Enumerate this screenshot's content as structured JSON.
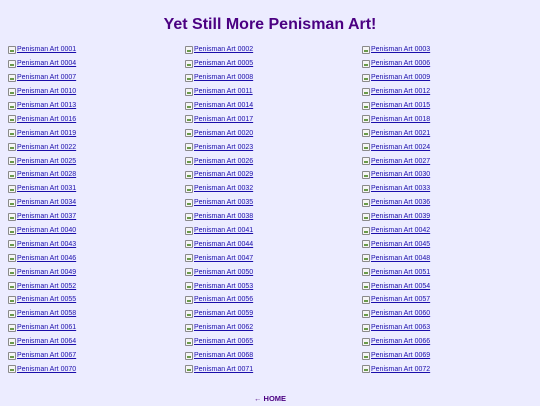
{
  "page": {
    "title": "Yet Still More Penisman Art!"
  },
  "gallery": {
    "items": [
      {
        "label": "Penisman Art 0001"
      },
      {
        "label": "Penisman Art 0002"
      },
      {
        "label": "Penisman Art 0003"
      },
      {
        "label": "Penisman Art 0004"
      },
      {
        "label": "Penisman Art 0005"
      },
      {
        "label": "Penisman Art 0006"
      },
      {
        "label": "Penisman Art 0007"
      },
      {
        "label": "Penisman Art 0008"
      },
      {
        "label": "Penisman Art 0009"
      },
      {
        "label": "Penisman Art 0010"
      },
      {
        "label": "Penisman Art 0011"
      },
      {
        "label": "Penisman Art 0012"
      },
      {
        "label": "Penisman Art 0013"
      },
      {
        "label": "Penisman Art 0014"
      },
      {
        "label": "Penisman Art 0015"
      },
      {
        "label": "Penisman Art 0016"
      },
      {
        "label": "Penisman Art 0017"
      },
      {
        "label": "Penisman Art 0018"
      },
      {
        "label": "Penisman Art 0019"
      },
      {
        "label": "Penisman Art 0020"
      },
      {
        "label": "Penisman Art 0021"
      },
      {
        "label": "Penisman Art 0022"
      },
      {
        "label": "Penisman Art 0023"
      },
      {
        "label": "Penisman Art 0024"
      },
      {
        "label": "Penisman Art 0025"
      },
      {
        "label": "Penisman Art 0026"
      },
      {
        "label": "Penisman Art 0027"
      },
      {
        "label": "Penisman Art 0028"
      },
      {
        "label": "Penisman Art 0029"
      },
      {
        "label": "Penisman Art 0030"
      },
      {
        "label": "Penisman Art 0031"
      },
      {
        "label": "Penisman Art 0032"
      },
      {
        "label": "Penisman Art 0033"
      },
      {
        "label": "Penisman Art 0034"
      },
      {
        "label": "Penisman Art 0035"
      },
      {
        "label": "Penisman Art 0036"
      },
      {
        "label": "Penisman Art 0037"
      },
      {
        "label": "Penisman Art 0038"
      },
      {
        "label": "Penisman Art 0039"
      },
      {
        "label": "Penisman Art 0040"
      },
      {
        "label": "Penisman Art 0041"
      },
      {
        "label": "Penisman Art 0042"
      },
      {
        "label": "Penisman Art 0043"
      },
      {
        "label": "Penisman Art 0044"
      },
      {
        "label": "Penisman Art 0045"
      },
      {
        "label": "Penisman Art 0046"
      },
      {
        "label": "Penisman Art 0047"
      },
      {
        "label": "Penisman Art 0048"
      },
      {
        "label": "Penisman Art 0049"
      },
      {
        "label": "Penisman Art 0050"
      },
      {
        "label": "Penisman Art 0051"
      },
      {
        "label": "Penisman Art 0052"
      },
      {
        "label": "Penisman Art 0053"
      },
      {
        "label": "Penisman Art 0054"
      },
      {
        "label": "Penisman Art 0055"
      },
      {
        "label": "Penisman Art 0056"
      },
      {
        "label": "Penisman Art 0057"
      },
      {
        "label": "Penisman Art 0058"
      },
      {
        "label": "Penisman Art 0059"
      },
      {
        "label": "Penisman Art 0060"
      },
      {
        "label": "Penisman Art 0061"
      },
      {
        "label": "Penisman Art 0062"
      },
      {
        "label": "Penisman Art 0063"
      },
      {
        "label": "Penisman Art 0064"
      },
      {
        "label": "Penisman Art 0065"
      },
      {
        "label": "Penisman Art 0066"
      },
      {
        "label": "Penisman Art 0067"
      },
      {
        "label": "Penisman Art 0068"
      },
      {
        "label": "Penisman Art 0069"
      },
      {
        "label": "Penisman Art 0070"
      },
      {
        "label": "Penisman Art 0071"
      },
      {
        "label": "Penisman Art 0072"
      }
    ],
    "thumbnail_icon": "broken-image-icon"
  },
  "footer": {
    "home_label": "← HOME"
  },
  "colors": {
    "background": "#ececff",
    "title": "#4b0082",
    "link": "#1a0dab"
  }
}
